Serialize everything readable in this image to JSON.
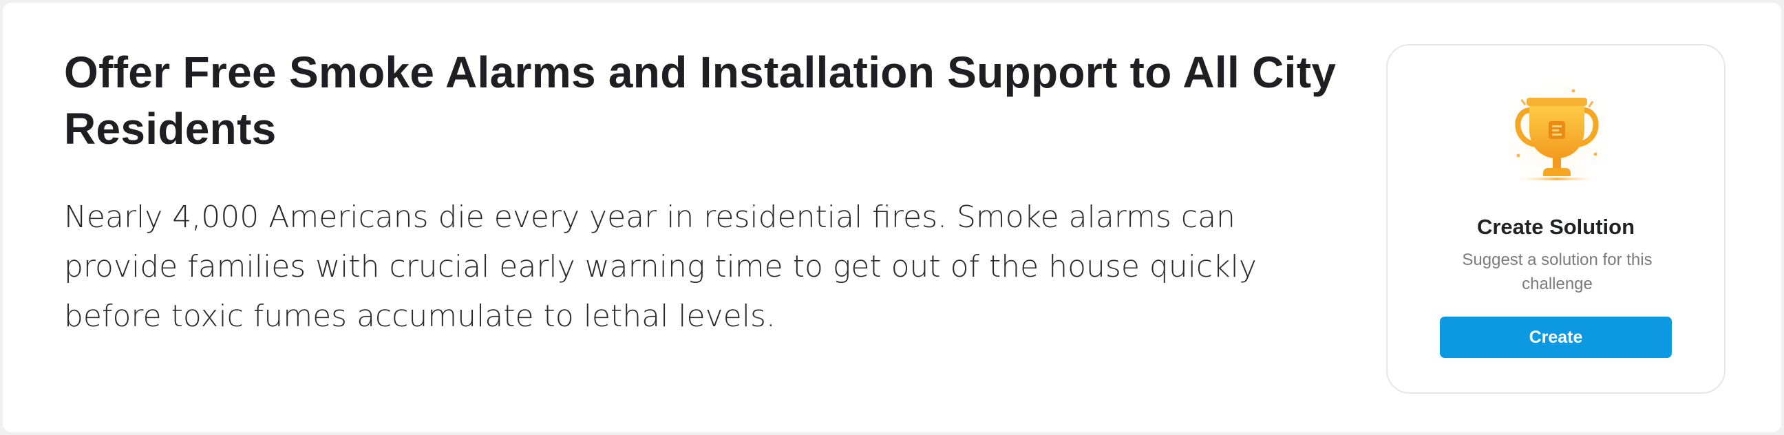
{
  "challenge": {
    "title": "Offer Free Smoke Alarms and Installation Support to All City Residents",
    "description": "Nearly 4,000 Americans die every year in residential fires. Smoke alarms can provide families with crucial early warning time to get out of the house quickly before toxic fumes accumulate to lethal levels."
  },
  "solution_card": {
    "icon": "trophy-icon",
    "title": "Create Solution",
    "subtitle": "Suggest a solution for this challenge",
    "button_label": "Create",
    "colors": {
      "button": "#0c99e2",
      "trophy": "#f5a623"
    }
  }
}
